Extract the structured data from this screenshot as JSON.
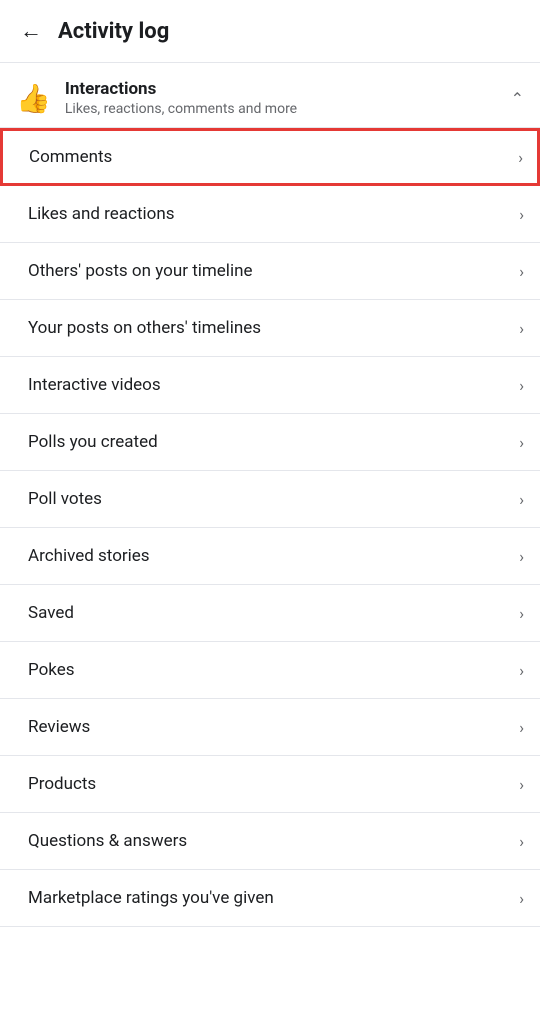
{
  "header": {
    "back_label": "←",
    "title": "Activity log"
  },
  "section": {
    "icon": "👍",
    "title": "Interactions",
    "subtitle": "Likes, reactions, comments and more",
    "collapse_icon": "^"
  },
  "menu_items": [
    {
      "label": "Comments",
      "highlighted": true
    },
    {
      "label": "Likes and reactions",
      "highlighted": false
    },
    {
      "label": "Others' posts on your timeline",
      "highlighted": false
    },
    {
      "label": "Your posts on others' timelines",
      "highlighted": false
    },
    {
      "label": "Interactive videos",
      "highlighted": false
    },
    {
      "label": "Polls you created",
      "highlighted": false
    },
    {
      "label": "Poll votes",
      "highlighted": false
    },
    {
      "label": "Archived stories",
      "highlighted": false
    },
    {
      "label": "Saved",
      "highlighted": false
    },
    {
      "label": "Pokes",
      "highlighted": false
    },
    {
      "label": "Reviews",
      "highlighted": false
    },
    {
      "label": "Products",
      "highlighted": false
    },
    {
      "label": "Questions & answers",
      "highlighted": false
    },
    {
      "label": "Marketplace ratings you've given",
      "highlighted": false
    }
  ],
  "icons": {
    "back_arrow": "←",
    "chevron_right": "›",
    "chevron_up": "^"
  }
}
